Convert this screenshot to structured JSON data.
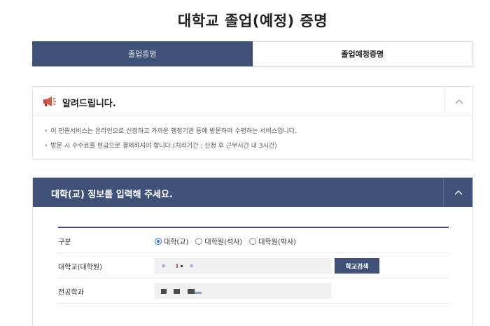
{
  "page": {
    "title": "대학교 졸업(예정) 증명"
  },
  "tabs": [
    {
      "label": "졸업증명",
      "active": false
    },
    {
      "label": "졸업예정증명",
      "active": true
    }
  ],
  "notice": {
    "title": "알려드립니다.",
    "icon": "megaphone-icon",
    "lines": [
      "이 민원서비스는 온라인으로 신청하고 가까운 행정기관 등에 방문하여 수령하는 서비스입니다.",
      "방문 시 수수료를 현금으로 결제하셔야 합니다.(처리기간 : 신청 후 근무시간 내 3시간)"
    ]
  },
  "form": {
    "title": "대학(교) 정보를 입력해 주세요.",
    "type_label": "구분",
    "type_options": [
      "대학(교)",
      "대학원(석사)",
      "대학원(박사)"
    ],
    "type_selected": "대학(교)",
    "school_label": "대학교(대학원)",
    "school_search_button": "학교검색",
    "major_label": "전공학과"
  },
  "colors": {
    "primary": "#3f5178",
    "radio_accent": "#3b73c9"
  }
}
